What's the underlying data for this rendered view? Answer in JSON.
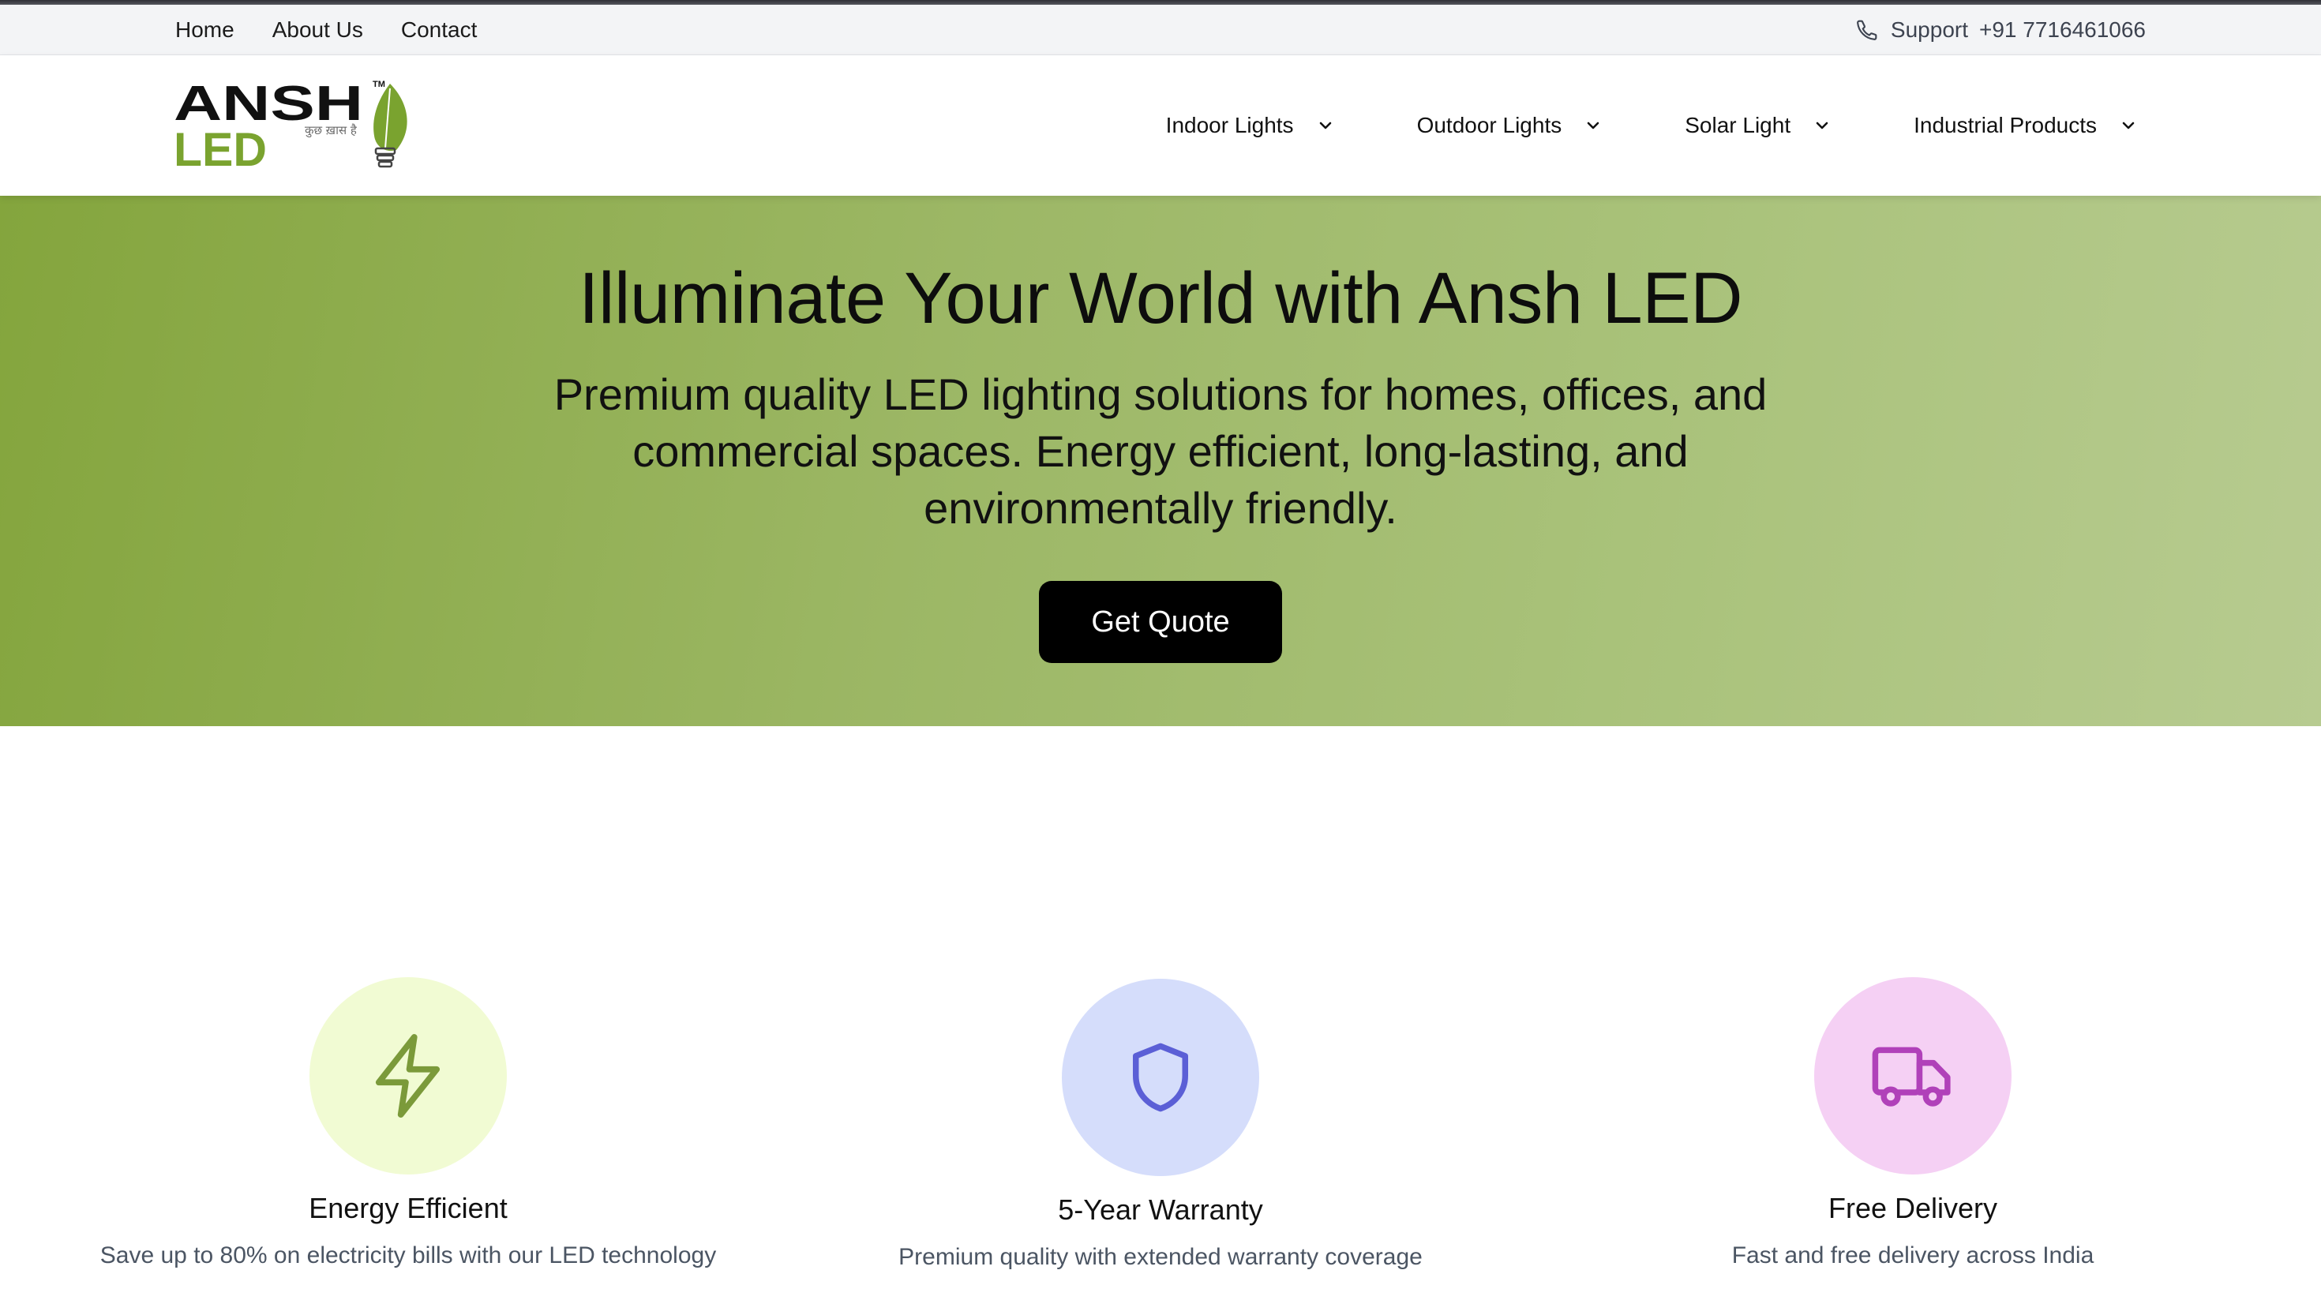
{
  "utility_bar": {
    "links": [
      "Home",
      "About Us",
      "Contact"
    ],
    "support_label": "Support",
    "phone": "+91 7716461066",
    "support_icon": "phone-icon"
  },
  "logo": {
    "wordmark_top": "ANSH",
    "wordmark_bottom": "LED",
    "tagline": "कुछ ख़ास है",
    "trademark": "TM",
    "icon": "leaf-bulb-icon"
  },
  "nav": {
    "items": [
      {
        "label": "Indoor Lights",
        "icon": "chevron-down-icon"
      },
      {
        "label": "Outdoor Lights",
        "icon": "chevron-down-icon"
      },
      {
        "label": "Solar Light",
        "icon": "chevron-down-icon"
      },
      {
        "label": "Industrial Products",
        "icon": "chevron-down-icon"
      }
    ]
  },
  "hero": {
    "title": "Illuminate Your World with Ansh LED",
    "subtitle": "Premium quality LED lighting solutions for homes, offices, and commercial spaces. Energy efficient, long-lasting, and environmentally friendly.",
    "cta_label": "Get Quote"
  },
  "features": [
    {
      "title": "Energy Efficient",
      "description": "Save up to 80% on electricity bills with our LED technology",
      "icon": "lightning-bolt-icon",
      "circle_color": "#f1fbd3",
      "icon_color": "#7b9a3a"
    },
    {
      "title": "5-Year Warranty",
      "description": "Premium quality with extended warranty coverage",
      "icon": "shield-icon",
      "circle_color": "#d5ddfb",
      "icon_color": "#5b5fd6"
    },
    {
      "title": "Free Delivery",
      "description": "Fast and free delivery across India",
      "icon": "truck-icon",
      "circle_color": "#f5d0f4",
      "icon_color": "#b041b9"
    }
  ],
  "colors": {
    "brand_green": "#7aa32f",
    "hero_gradient_start": "#84a53d",
    "hero_gradient_end": "#b7cb90",
    "cta_background": "#000000"
  }
}
